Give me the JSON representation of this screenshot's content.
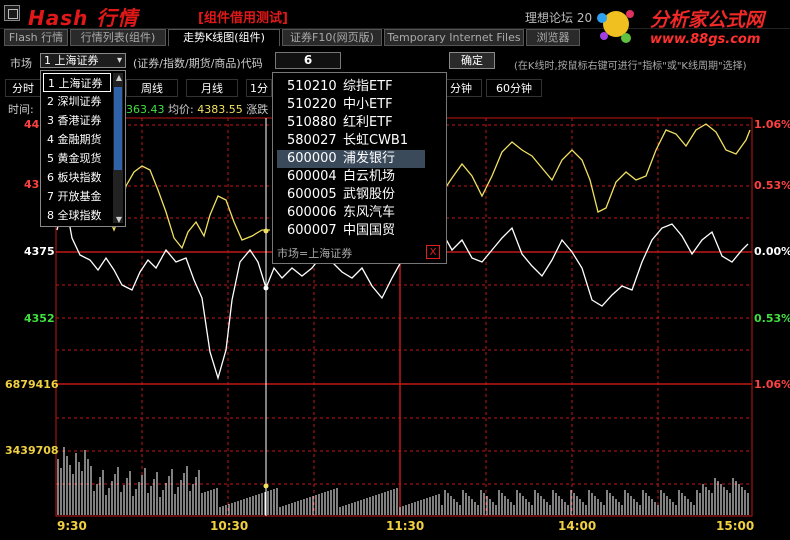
{
  "app": {
    "brand": "Hash 行情",
    "subtitle": "[组件借用测试]",
    "forum": "理想论坛 20"
  },
  "logo": {
    "name": "分析家公式网",
    "url": "www.88gs.com"
  },
  "top_tabs": [
    {
      "label": "Flash 行情",
      "active": false
    },
    {
      "label": "行情列表(组件)",
      "active": false
    },
    {
      "label": "走势K线图(组件)",
      "active": true
    },
    {
      "label": "证券F10(网页版)",
      "active": false
    },
    {
      "label": "Temporary Internet Files",
      "active": false
    },
    {
      "label": "浏览器",
      "active": false
    }
  ],
  "toolbar": {
    "market_label": "市场",
    "market_value": "1 上海证券",
    "code_label": "(证券/指数/期货/商品)代码",
    "code_value": "6",
    "confirm": "确定",
    "hint": "(在K线时,按鼠标右键可进行\"指标\"或\"K线周期\"选择)"
  },
  "period_tabs": [
    "分时",
    "周线",
    "月线",
    "1分",
    "分钟",
    "60分钟"
  ],
  "info": {
    "time_label": "时间:",
    "price": "363.43",
    "avg_label": "均价:",
    "avg": "4383.55",
    "change_label": "涨跌"
  },
  "market_dropdown": [
    "1 上海证券",
    "2 深圳证券",
    "3 香港证券",
    "4 金融期货",
    "5 黄金现货",
    "6 板块指数",
    "7 开放基金",
    "8 全球指数"
  ],
  "stock_popup": {
    "rows": [
      {
        "code": "510210",
        "name": "综指ETF"
      },
      {
        "code": "510220",
        "name": "中小ETF"
      },
      {
        "code": "510880",
        "name": "红利ETF"
      },
      {
        "code": "580027",
        "name": "长虹CWB1"
      },
      {
        "code": "600000",
        "name": "浦发银行"
      },
      {
        "code": "600004",
        "name": "白云机场"
      },
      {
        "code": "600005",
        "name": "武钢股份"
      },
      {
        "code": "600006",
        "name": "东风汽车"
      },
      {
        "code": "600007",
        "name": "中国国贸"
      }
    ],
    "selected": 4,
    "footer": "市场=上海证券",
    "close": "X"
  },
  "price_axis": {
    "left": [
      {
        "text": "44",
        "color": "#ff4040"
      },
      {
        "text": "43",
        "color": "#ff4040"
      },
      {
        "text": "4375",
        "color": "#ffffff"
      },
      {
        "text": "4352",
        "color": "#40e040"
      },
      {
        "text": "6879416",
        "color": "#f0d040"
      },
      {
        "text": "3439708",
        "color": "#f0d040"
      }
    ],
    "right": [
      {
        "text": "1.06%",
        "color": "#ff4040"
      },
      {
        "text": "0.53%",
        "color": "#ff4040"
      },
      {
        "text": "0.00%",
        "color": "#ffffff"
      },
      {
        "text": "0.53%",
        "color": "#40e040"
      },
      {
        "text": "1.06%",
        "color": "#ff4040"
      }
    ]
  },
  "time_axis": [
    "9:30",
    "10:30",
    "11:30",
    "14:00",
    "15:00"
  ],
  "colors": {
    "grid": "#c01818",
    "price": "#ffffff",
    "avg": "#f0e060",
    "volume": "#ffffff",
    "cursor": "#ffffff"
  }
}
